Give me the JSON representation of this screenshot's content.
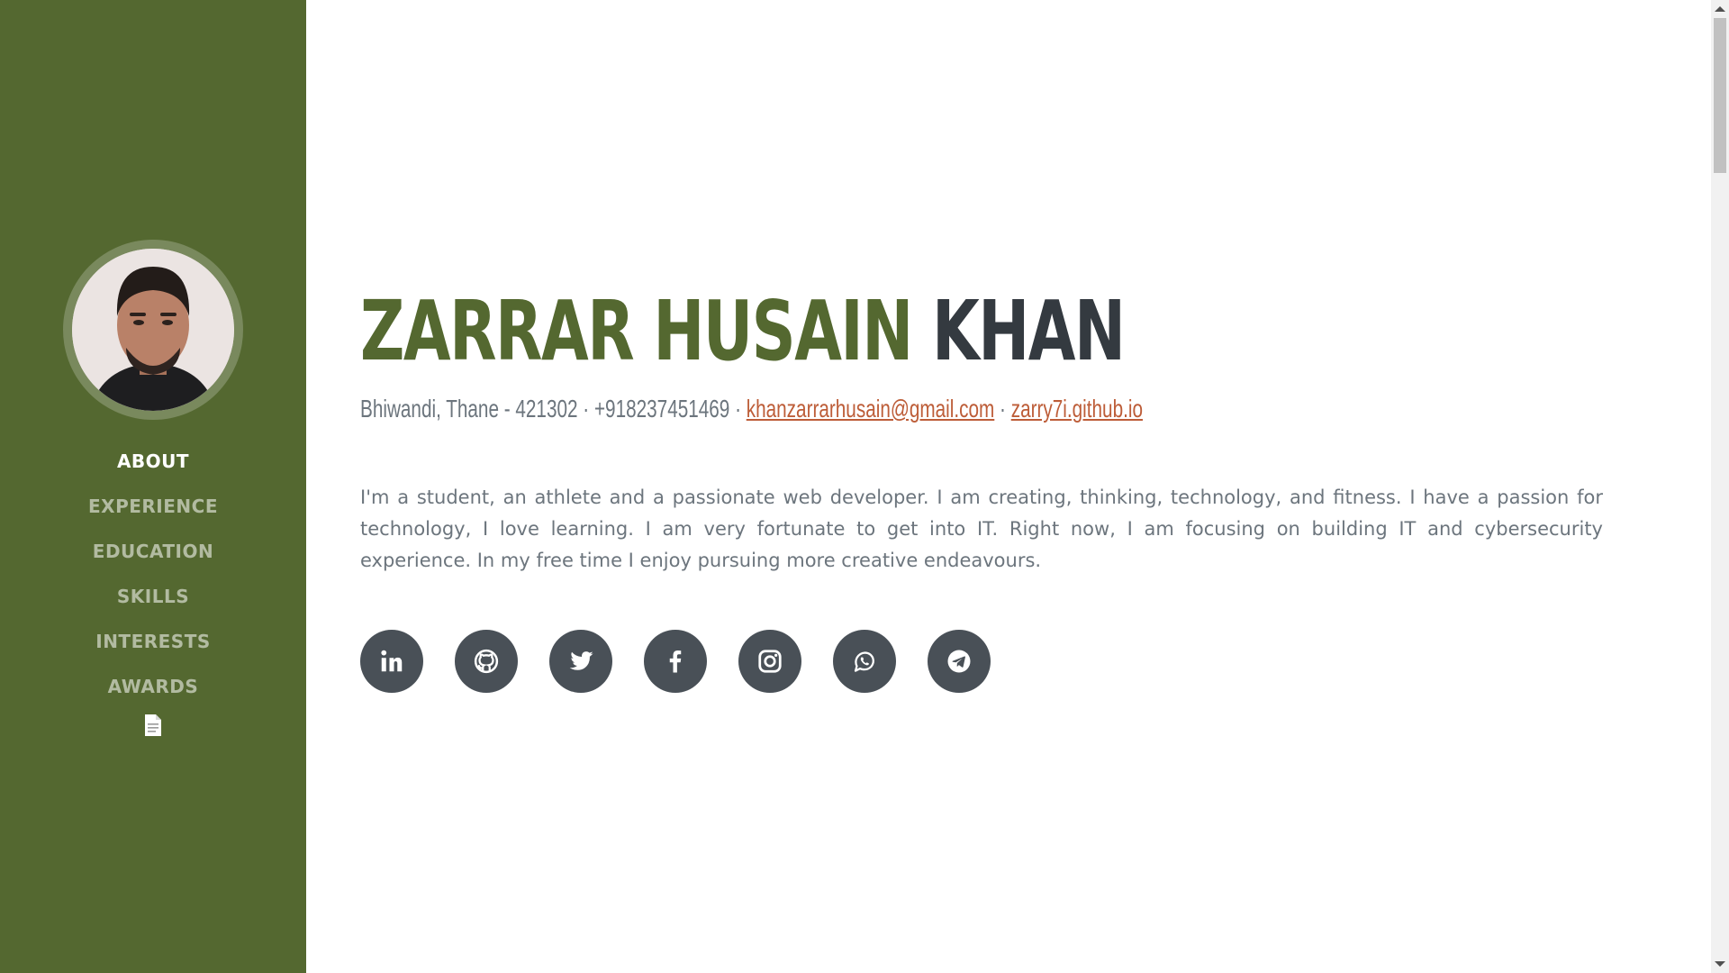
{
  "profile": {
    "first_name": "ZARRAR HUSAIN",
    "last_name": "KHAN",
    "location": "Bhiwandi, Thane - 421302",
    "phone": "+918237451469",
    "email": "khanzarrarhusain@gmail.com",
    "website": "zarry7i.github.io",
    "separator": " · ",
    "bio": "I'm a student, an athlete and a passionate web developer. I am creating, thinking, technology, and fitness. I have a passion for technology, I love learning. I am very fortunate to get into IT. Right now, I am focusing on building IT and cybersecurity experience. In my free time I enjoy pursuing more creative endeavours."
  },
  "nav": {
    "items": [
      {
        "label": "ABOUT",
        "active": true
      },
      {
        "label": "EXPERIENCE",
        "active": false
      },
      {
        "label": "EDUCATION",
        "active": false
      },
      {
        "label": "SKILLS",
        "active": false
      },
      {
        "label": "INTERESTS",
        "active": false
      },
      {
        "label": "AWARDS",
        "active": false
      }
    ],
    "resume_icon": "document-icon"
  },
  "social": [
    "linkedin-icon",
    "github-icon",
    "twitter-icon",
    "facebook-icon",
    "instagram-icon",
    "whatsapp-icon",
    "telegram-icon"
  ],
  "colors": {
    "sidebar": "#546830",
    "accent": "#bd5d38",
    "dark": "#343a40",
    "muted": "#6c757d",
    "social_bg": "#495057"
  }
}
